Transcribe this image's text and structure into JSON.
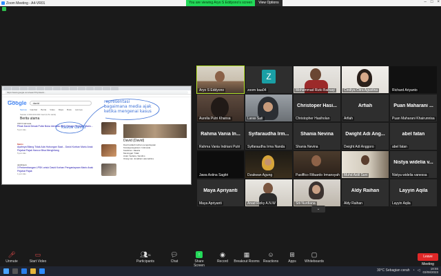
{
  "window": {
    "title": "Zoom Meeting - A4-VR01"
  },
  "share_banner": {
    "message": "You are viewing Aryo S Eddyono's screen",
    "view_options": "View Options"
  },
  "shared_screen": {
    "address": "https://www.google.com/search?q=david...",
    "search_query": "david",
    "google_logo": "Google",
    "search_tabs": [
      "Semua",
      "Gambar",
      "Berita",
      "Video",
      "Maps",
      "Buku",
      "Lainnya"
    ],
    "results_count": "Sekitar 2.060.000.000 hasil (0,51 detik)",
    "top_news": "Berita utama",
    "news": [
      {
        "source": "CNN Indonesia",
        "headline": "Pihak David Desak Polisi Buka Identitas ABG Diduga Perekam Mario...",
        "ago": "5 jam lalu"
      },
      {
        "source": "Matrix",
        "headline": "Ayahnya Bilang Tidak Ada Hubungan Saat... David Korban Mario Anak Pejabat Pajak Hancur Bisa Menghilang",
        "ago": "5 jam lalu"
      },
      {
        "source": "detikNews",
        "headline": "3 Perkembangan LPSK untuk David Korban Penganiayaan Mario Anak Pejabat Pajak",
        "ago": "1 jam lalu"
      }
    ],
    "knowledge_panel": {
      "title": "David (David)",
      "lines": [
        "David adalah korban penganiayaan",
        "Kewarganegaraan: Indonesia",
        "Kelahiran: Jakarta",
        "Meninggal: Tidak",
        "Anak: Sedana, Sandino",
        "Orang tua: Jonathan Latumahina"
      ]
    },
    "annotations": {
      "left": "kasus david",
      "right": [
        "representasi",
        "bagaimana media ajak",
        "ketika mengenai kasus"
      ]
    }
  },
  "participants": [
    {
      "name": "Aryo S Eddyono",
      "kind": "video",
      "active": true
    },
    {
      "name": "zoom baa04",
      "kind": "avatar",
      "initial": "Z"
    },
    {
      "name": "Mohammad Rizki Baihaqi",
      "kind": "video"
    },
    {
      "name": "Cindiya Citra Agustina",
      "kind": "video"
    },
    {
      "name": "Richard Ariyanto",
      "kind": "blank"
    },
    {
      "name": "Aurelia Putri Khansa",
      "kind": "video"
    },
    {
      "name": "Laras Sati",
      "kind": "video"
    },
    {
      "name": "Christopher Hasiholan",
      "kind": "name",
      "display": "Christoper Hasi..."
    },
    {
      "name": "Arfiah",
      "kind": "name",
      "display": "Arfiah"
    },
    {
      "name": "Puan Maharani Khairunnisa",
      "kind": "name",
      "display": "Puan Maharani ..."
    },
    {
      "name": "Rahma Vania Indriani Putri",
      "kind": "name",
      "display": "Rahma Vania In..."
    },
    {
      "name": "Syifaraudha Irma Nanda",
      "kind": "name",
      "display": "Syifaraudha Irm..."
    },
    {
      "name": "Shania Nevina",
      "kind": "name",
      "display": "Shania Nevina"
    },
    {
      "name": "Dwight Adi Anggoro",
      "kind": "name",
      "display": "Dwight Adi Ang..."
    },
    {
      "name": "abel fatan",
      "kind": "name",
      "display": "abel fatan"
    },
    {
      "name": "Jawa Astina Sagitri",
      "kind": "video"
    },
    {
      "name": "Dzakwan Agung",
      "kind": "video"
    },
    {
      "name": "Pasiffico Rifaardo Irmansyah",
      "kind": "video"
    },
    {
      "name": "Muhd Aidil Sani",
      "kind": "video"
    },
    {
      "name": "Nistya widelia vanessa",
      "kind": "name",
      "display": "Nistya widelia v..."
    },
    {
      "name": "Maya Apriyanti",
      "kind": "name",
      "display": "Maya Apriyanti"
    },
    {
      "name": "Anad Rizky A.N.W",
      "kind": "video"
    },
    {
      "name": "Siti Nurdiana",
      "kind": "video"
    },
    {
      "name": "Aldy Raihan",
      "kind": "name",
      "display": "Aldy Raihan"
    },
    {
      "name": "Layyin Aqila",
      "kind": "name",
      "display": "Layyin Aqila"
    }
  ],
  "toolbar": {
    "unmute": "Unmute",
    "start_video": "Start Video",
    "participants": "Participants",
    "participants_count": "31",
    "chat": "Chat",
    "share_screen": "Share Screen",
    "record": "Record",
    "breakout": "Breakout Rooms",
    "reactions": "Reactions",
    "apps": "Apps",
    "whiteboards": "Whiteboards",
    "leave": "Leave Meeting"
  },
  "taskbar": {
    "weather": "30°C  Sebagian cerah",
    "time": "18:55",
    "date": "03/08/2023"
  },
  "colors": {
    "share_green": "#23d959",
    "leave_red": "#e02828",
    "active_speaker": "#b8e62a"
  }
}
